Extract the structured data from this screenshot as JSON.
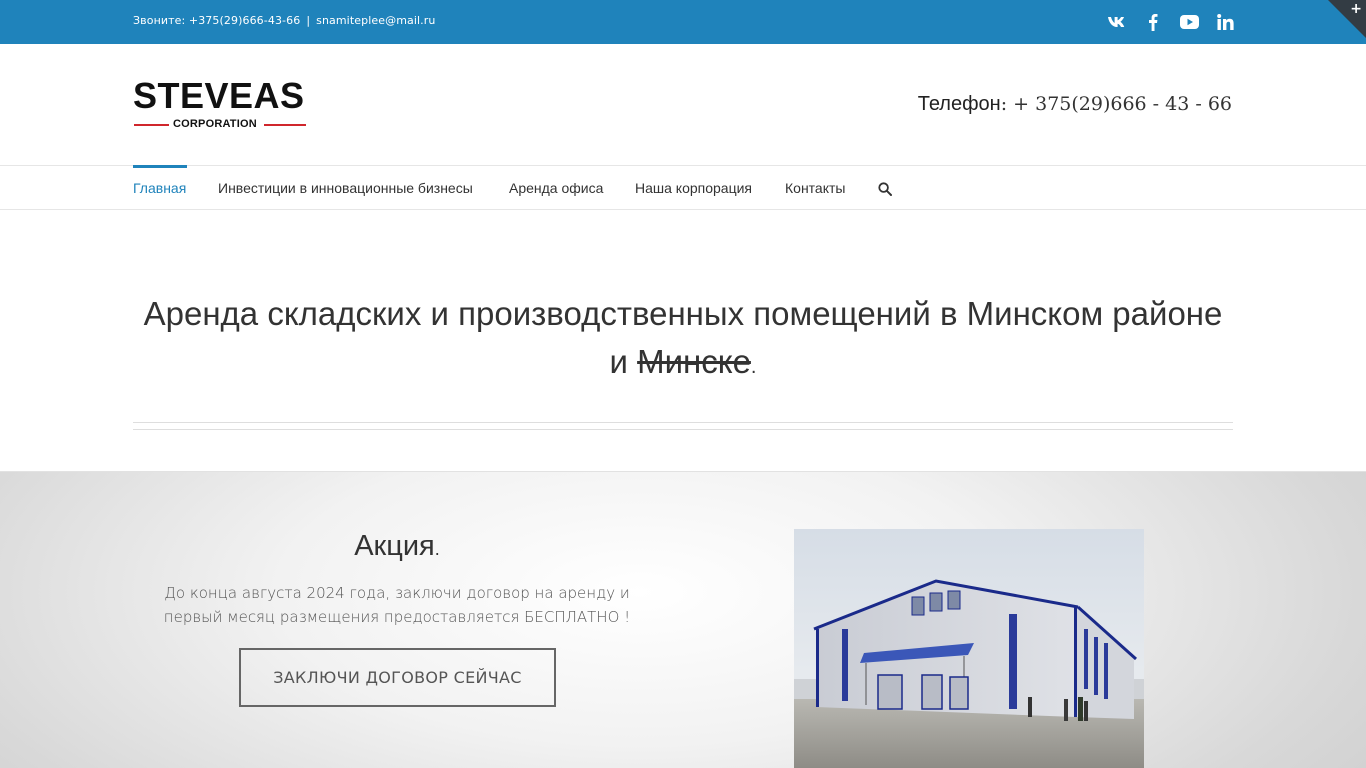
{
  "topbar": {
    "phone_text": "Звоните: +375(29)666-43-66",
    "separator": "|",
    "email": "snamiteplee@mail.ru",
    "social_icons": [
      "vk-icon",
      "facebook-icon",
      "youtube-icon",
      "linkedin-icon"
    ],
    "background_color": "#1f83bb",
    "corner_toggle": "+"
  },
  "header": {
    "logo_main": "STEVEAS",
    "logo_sub": "CORPORATION",
    "phone_label": "Телефон",
    "phone_colon": ":",
    "phone_number": " + 375(29)666 - 43 - 66"
  },
  "nav": {
    "items": [
      {
        "label": "Главная",
        "active": true
      },
      {
        "label": "Инвестиции в инновационные бизнесы",
        "active": false
      },
      {
        "label": "Аренда офиса",
        "active": false
      },
      {
        "label": "Наша корпорация",
        "active": false
      },
      {
        "label": "Контакты",
        "active": false
      }
    ],
    "search_icon": "search-icon",
    "accent_color": "#1f83bb"
  },
  "hero": {
    "title_line1": "Аренда складских и производственных помещений в Минском районе",
    "title_line2_prefix": "и ",
    "title_line2_strike": "Минске",
    "title_line2_suffix": "."
  },
  "promo": {
    "title": "Акция",
    "title_dot": ".",
    "text": "До конца августа 2024 года, заключи договор на аренду и первый месяц размещения предоставляется БЕСПЛАТНО !",
    "button_label": "ЗАКЛЮЧИ ДОГОВОР СЕЙЧАС"
  }
}
